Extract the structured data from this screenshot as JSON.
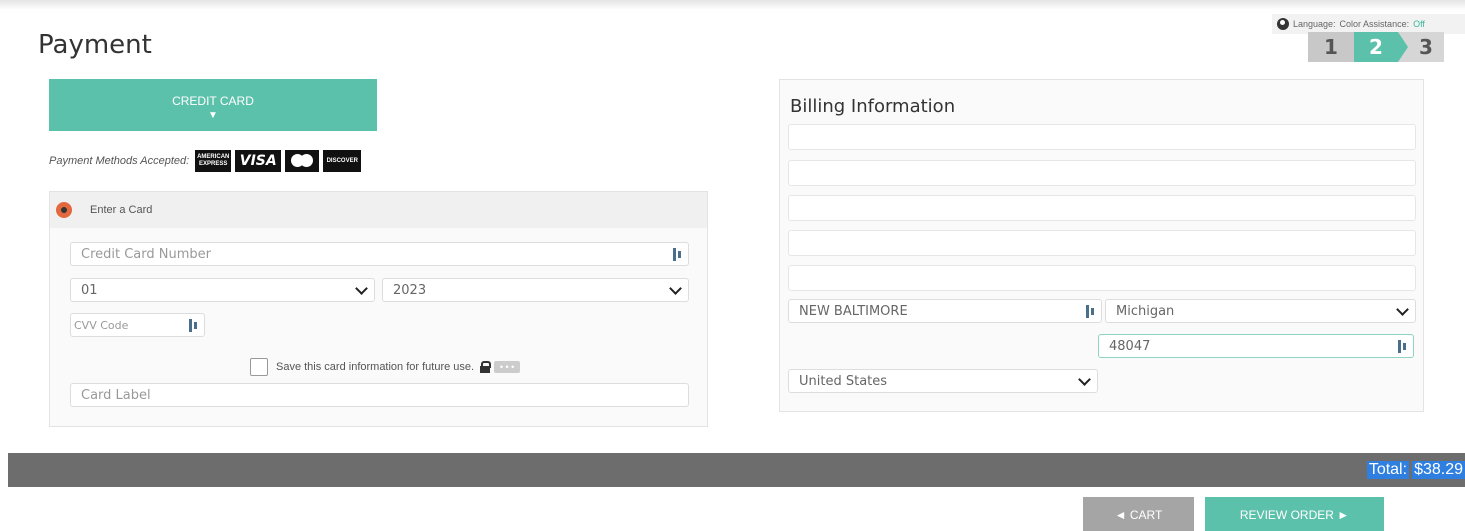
{
  "page": {
    "title": "Payment"
  },
  "header": {
    "language_label": "Language:",
    "color_assist_label": "Color Assistance:",
    "color_assist_value": "Off",
    "steps": [
      "1",
      "2",
      "3"
    ],
    "active_step": 2
  },
  "payment": {
    "tab_label": "CREDIT CARD",
    "tab_arrow": "▼",
    "methods_label": "Payment Methods Accepted:",
    "logos": {
      "amex": "AMERICAN EXPRESS",
      "visa": "VISA",
      "mastercard": "mastercard",
      "discover": "DISCOVER"
    },
    "enter_card_label": "Enter a Card",
    "card_number_placeholder": "Credit Card Number",
    "exp_month": "01",
    "exp_year": "2023",
    "cvv_placeholder": "CVV Code",
    "save_label": "Save this card information for future use.",
    "more_dots": "• • •",
    "card_label_placeholder": "Card Label"
  },
  "billing": {
    "title": "Billing Information",
    "city": "NEW BALTIMORE",
    "state": "Michigan",
    "zip": "48047",
    "country": "United States"
  },
  "summary": {
    "total_label": "Total:",
    "total_value": "$38.29"
  },
  "actions": {
    "cart_label": "◄ CART",
    "review_label": "REVIEW ORDER ►"
  },
  "colors": {
    "accent": "#5cc1ab",
    "radio": "#e3683f",
    "bar": "#6d6d6d",
    "cart_button": "#a5a5a5"
  }
}
